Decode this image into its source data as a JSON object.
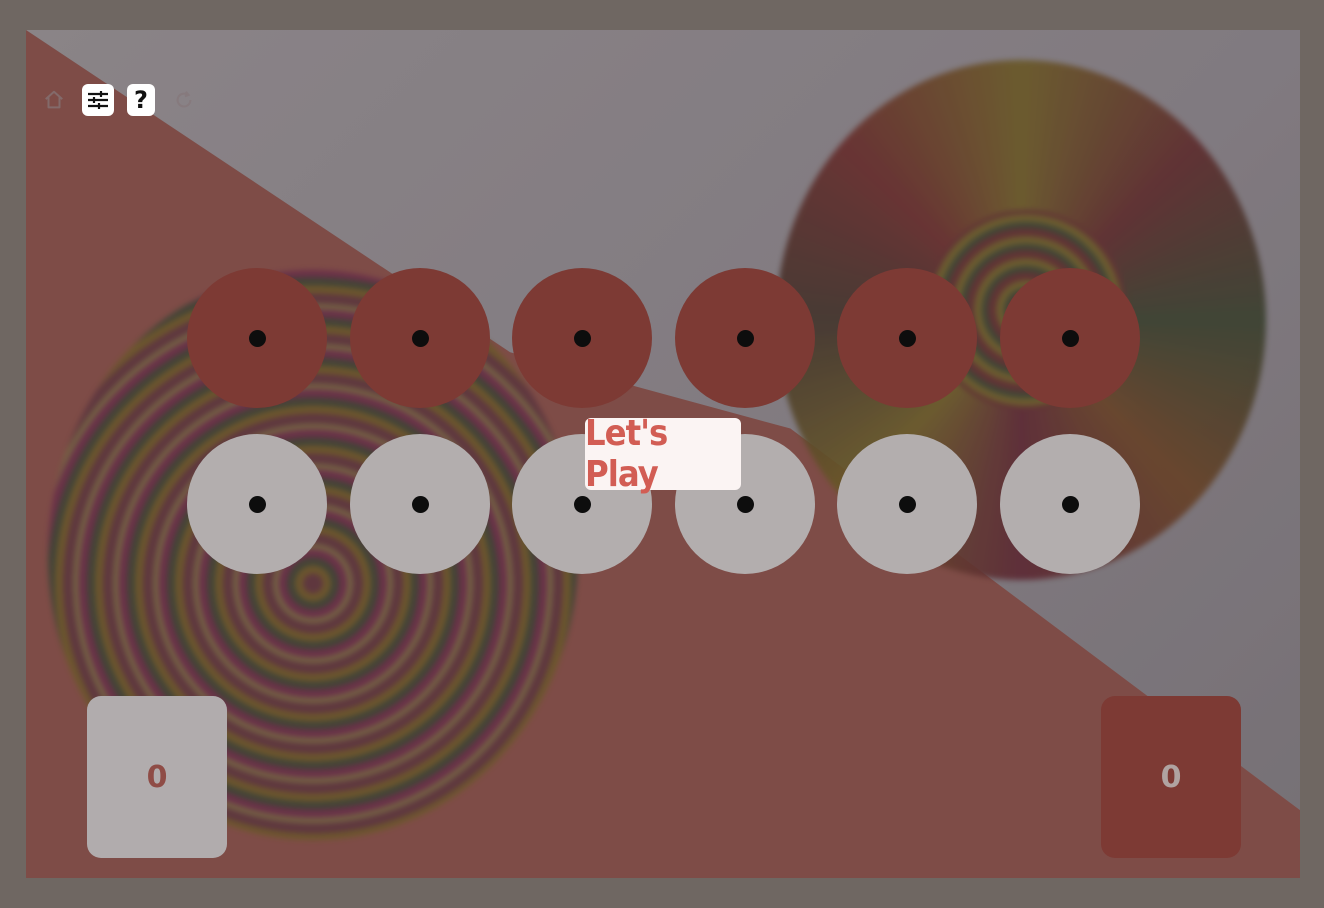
{
  "toolbar": {
    "buttons": [
      {
        "icon": "home-icon",
        "state": "faded"
      },
      {
        "icon": "sliders-icon",
        "state": "active"
      },
      {
        "icon": "question-icon",
        "state": "active",
        "glyph": "?"
      },
      {
        "icon": "restart-icon",
        "state": "faded"
      }
    ]
  },
  "board": {
    "opponent_pits": [
      1,
      1,
      1,
      1,
      1,
      1
    ],
    "player_pits": [
      1,
      1,
      1,
      1,
      1,
      1
    ],
    "player_store": "0",
    "opponent_store": "0"
  },
  "modal": {
    "play_label": "Let's Play"
  },
  "colors": {
    "accent": "#d25d54",
    "opponent_pit": "#7d3a34",
    "player_pit": "#b3aeae",
    "seed": "#0d0d0d",
    "modal_bg": "#fbf4f3"
  }
}
